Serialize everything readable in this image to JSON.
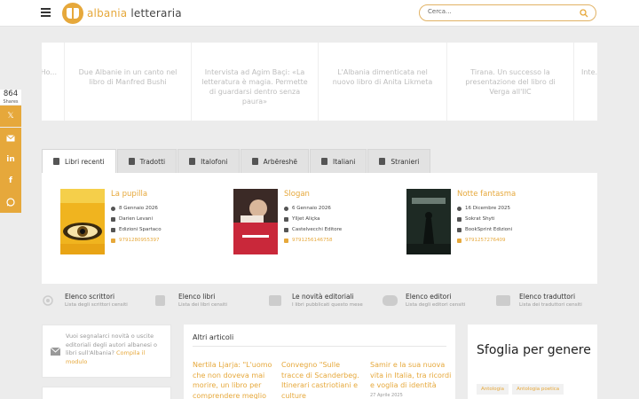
{
  "header": {
    "logo_part1": "albania",
    "logo_part2": "letteraria",
    "search_placeholder": "Cerca..."
  },
  "share": {
    "count": "864",
    "label": "Shares"
  },
  "carousel": [
    {
      "title": "Ho...",
      "cat": "",
      "date": ""
    },
    {
      "title": "Due Albanie in un canto nel libro di Manfred Bushi",
      "cat": "",
      "date": ""
    },
    {
      "title": "Intervista ad Agim Baçi: «La letteratura è magia. Permette di guardarsi dentro senza paura»",
      "cat": "",
      "date": ""
    },
    {
      "title": "L'Albania dimenticata nel nuovo libro di Anita Likmeta",
      "cat": "",
      "date": ""
    },
    {
      "title": "Tirana. Un successo la presentazione del libro di Verga all'IIC",
      "cat": "",
      "date": ""
    },
    {
      "title": "Inte...",
      "cat": "",
      "date": ""
    }
  ],
  "tabs": [
    {
      "label": "Libri recenti",
      "active": true
    },
    {
      "label": "Tradotti"
    },
    {
      "label": "Italofoni"
    },
    {
      "label": "Arbëreshë"
    },
    {
      "label": "Italiani"
    },
    {
      "label": "Stranieri"
    }
  ],
  "books": [
    {
      "title": "La pupilla",
      "date": "8 Gennaio 2026",
      "author": "Darien Levani",
      "publisher": "Edizioni Spartaco",
      "isbn": "9791280955397"
    },
    {
      "title": "Slogan",
      "date": "6 Gennaio 2026",
      "author": "Ylljet Aliçka",
      "publisher": "Castelvecchi Editore",
      "isbn": "9791256146758"
    },
    {
      "title": "Notte fantasma",
      "date": "16 Dicembre 2025",
      "author": "Sokrat Shyti",
      "publisher": "BookSprint Edizioni",
      "isbn": "9791257276409"
    }
  ],
  "sections": [
    {
      "title": "Elenco scrittori",
      "sub": "Lista degli scrittori censiti"
    },
    {
      "title": "Elenco libri",
      "sub": "Lista dei libri censiti"
    },
    {
      "title": "Le novità editoriali",
      "sub": "I libri pubblicati questo mese"
    },
    {
      "title": "Elenco editori",
      "sub": "Lista degli editori censiti"
    },
    {
      "title": "Elenco traduttori",
      "sub": "Lista dei traduttori censiti"
    }
  ],
  "notice": {
    "text": "Vuoi segnalarci novità o uscite editoriali degli autori albanesi o libri sull'Albania?",
    "link": "Compila il modulo"
  },
  "articles": {
    "heading": "Altri articoli",
    "items": [
      {
        "title": "Nertila Ljarja: \"L'uomo che non doveva mai morire, un libro per comprendere meglio",
        "date": ""
      },
      {
        "title": "Convegno \"Sulle tracce di Scanderbeg. Itinerari castriotiani e culture",
        "date": ""
      },
      {
        "title": "Samir e la sua nuova vita in Italia, tra ricordi e voglia di identità",
        "date": "27 Aprile 2025"
      }
    ]
  },
  "browse": {
    "heading": "Sfoglia per genere",
    "tags": [
      "Antologia",
      "Antologia poetica"
    ]
  },
  "colors": {
    "accent": "#e6a83b"
  }
}
